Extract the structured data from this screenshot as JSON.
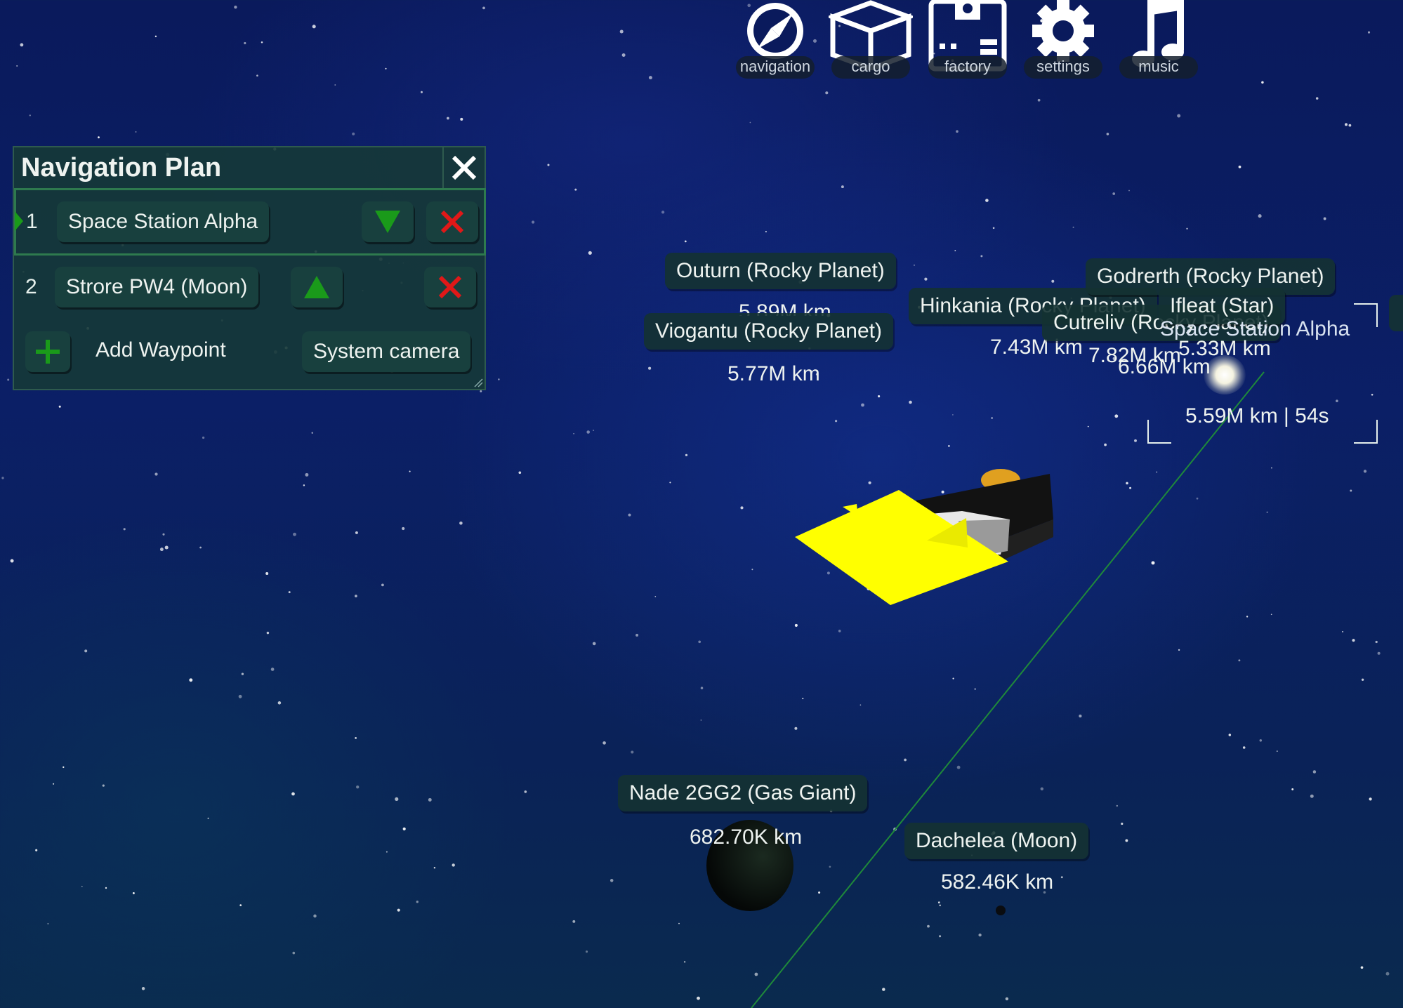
{
  "hud": {
    "buttons": [
      {
        "label": "navigation",
        "icon": "compass-icon"
      },
      {
        "label": "cargo",
        "icon": "box-icon"
      },
      {
        "label": "factory",
        "icon": "factory-icon"
      },
      {
        "label": "settings",
        "icon": "gear-icon"
      },
      {
        "label": "music",
        "icon": "music-note-icon"
      }
    ]
  },
  "nav_panel": {
    "title": "Navigation Plan",
    "waypoints": [
      {
        "index": "1",
        "name": "Space Station Alpha"
      },
      {
        "index": "2",
        "name": "Strore PW4 (Moon)"
      }
    ],
    "add_label": "Add Waypoint",
    "camera_label": "System camera",
    "colors": {
      "move_down": "#1a9a1a",
      "move_up": "#1a9a1a",
      "remove": "#e01818",
      "add": "#1a9a1a"
    }
  },
  "bodies": [
    {
      "name": "Outurn (Rocky Planet)",
      "distance": "5.89M km"
    },
    {
      "name": "Viogantu (Rocky Planet)",
      "distance": "5.77M km"
    },
    {
      "name": "Hinkania (Rocky Planet)",
      "distance": "7.43M km"
    },
    {
      "name": "Cutreliv (Rocky Planet)",
      "distance": "7.82M km"
    },
    {
      "name": "Godrerth (Rocky Planet)",
      "distance": "6.66M km"
    },
    {
      "name": "Ifleat (Star)",
      "distance": "5.33M km"
    },
    {
      "name": "Nade 2GG2 (Gas Giant)",
      "distance": "682.70K km"
    },
    {
      "name": "Dachelea (Moon)",
      "distance": "582.46K km"
    }
  ],
  "target": {
    "name": "Space Station Alpha",
    "readout": "5.59M km | 54s"
  }
}
